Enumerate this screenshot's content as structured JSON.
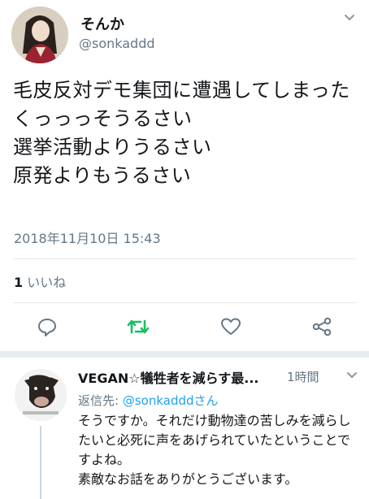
{
  "tweet": {
    "display_name": "そんか",
    "handle": "@sonkaddd",
    "text": "毛皮反対デモ集団に遭遇してしまった\nくっっっそうるさい\n選挙活動よりうるさい\n原発よりもうるさい",
    "timestamp": "2018年11月10日 15:43",
    "likes_count": "1",
    "likes_label": "いいね"
  },
  "actions": [
    "reply-icon",
    "retweet-icon",
    "like-icon",
    "share-icon"
  ],
  "reply": {
    "display_name": "VEGAN☆犠牲者を減らす最...",
    "time": "1時間",
    "reply_to_prefix": "返信先: ",
    "reply_to_mention": "@sonkadddさん",
    "text": "そうですか。それだけ動物達の苦しみを減らしたいと必死に声をあげられていたということですよね。\n素敵なお話をありがとうございます。"
  },
  "colors": {
    "text": "#14171a",
    "secondary": "#657786",
    "accent": "#1da1f2",
    "retweet_active": "#17bf63",
    "divider": "#e1e8ed"
  }
}
